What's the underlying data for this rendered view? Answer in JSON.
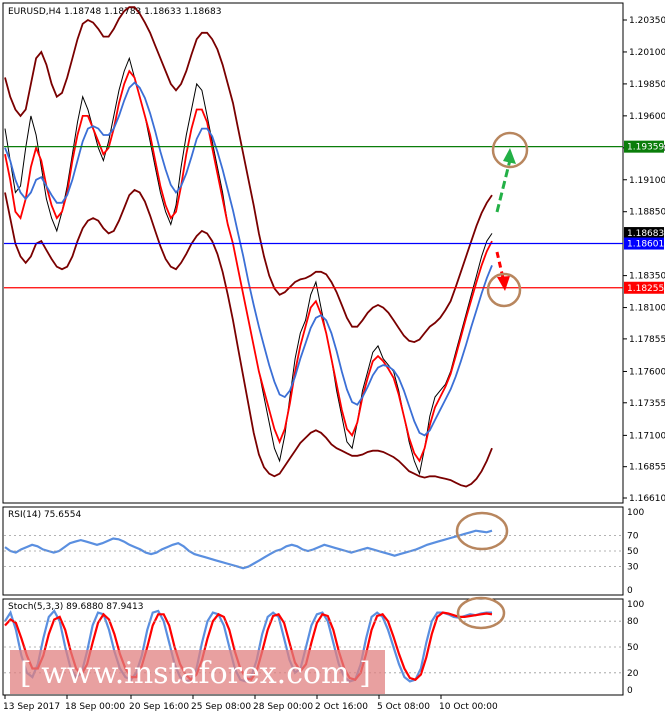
{
  "chart_data": [
    {
      "type": "line",
      "title": "EURUSD,H4  1.18748 1.18783 1.18633 1.18683",
      "symbol": "EURUSD,H4",
      "ohlc": {
        "open": 1.18748,
        "high": 1.18783,
        "low": 1.18633,
        "close": 1.18683
      },
      "ylim": [
        1.1661,
        1.2035
      ],
      "ytick_labels": [
        "1.20350",
        "1.20100",
        "1.19850",
        "1.19600",
        "1.19350",
        "1.19100",
        "1.18850",
        "1.18350",
        "1.18100",
        "1.17855",
        "1.17600",
        "1.17355",
        "1.17100",
        "1.16855",
        "1.16610"
      ],
      "price_levels": [
        {
          "name": "resistance",
          "value": "1.19359",
          "color": "#0a7d0a"
        },
        {
          "name": "current",
          "value": "1.18683",
          "color": "#000000"
        },
        {
          "name": "pivot",
          "value": "1.18601",
          "color": "#0000ff"
        },
        {
          "name": "support",
          "value": "1.18255",
          "color": "#ff0000"
        }
      ],
      "x_labels": [
        "13 Sep 2017",
        "18 Sep 00:00",
        "20 Sep 16:00",
        "25 Sep 08:00",
        "28 Sep 00:00",
        "2 Oct 16:00",
        "5 Oct 08:00",
        "10 Oct 00:00"
      ],
      "series": [
        {
          "name": "price",
          "color": "#000000",
          "values": [
            1.195,
            1.1925,
            1.19,
            1.1905,
            1.1935,
            1.196,
            1.1945,
            1.192,
            1.1895,
            1.188,
            1.187,
            1.1885,
            1.1905,
            1.193,
            1.1955,
            1.1975,
            1.1965,
            1.195,
            1.1935,
            1.1925,
            1.194,
            1.196,
            1.198,
            1.1995,
            1.2005,
            1.199,
            1.1975,
            1.196,
            1.194,
            1.192,
            1.19,
            1.1885,
            1.1875,
            1.189,
            1.192,
            1.1945,
            1.1965,
            1.1985,
            1.198,
            1.196,
            1.194,
            1.192,
            1.19,
            1.1875,
            1.186,
            1.184,
            1.182,
            1.18,
            1.178,
            1.176,
            1.174,
            1.172,
            1.17,
            1.169,
            1.171,
            1.174,
            1.177,
            1.179,
            1.18,
            1.182,
            1.183,
            1.181,
            1.179,
            1.177,
            1.1745,
            1.1725,
            1.1705,
            1.17,
            1.172,
            1.1745,
            1.176,
            1.1775,
            1.178,
            1.177,
            1.1765,
            1.176,
            1.1745,
            1.1725,
            1.1705,
            1.169,
            1.168,
            1.17,
            1.1725,
            1.174,
            1.1745,
            1.175,
            1.176,
            1.1775,
            1.179,
            1.1805,
            1.182,
            1.1835,
            1.185,
            1.1862,
            1.1868
          ]
        },
        {
          "name": "ma-red",
          "color": "#ff0000",
          "values": [
            1.193,
            1.191,
            1.1885,
            1.188,
            1.1895,
            1.192,
            1.1935,
            1.1925,
            1.1905,
            1.189,
            1.188,
            1.1885,
            1.19,
            1.1925,
            1.1945,
            1.196,
            1.196,
            1.195,
            1.194,
            1.193,
            1.1935,
            1.195,
            1.197,
            1.1985,
            1.1995,
            1.199,
            1.1975,
            1.196,
            1.1945,
            1.1925,
            1.1905,
            1.189,
            1.188,
            1.1885,
            1.1905,
            1.193,
            1.195,
            1.1965,
            1.1965,
            1.1955,
            1.1935,
            1.1915,
            1.1895,
            1.1875,
            1.186,
            1.184,
            1.182,
            1.18,
            1.178,
            1.176,
            1.1745,
            1.173,
            1.1715,
            1.1705,
            1.1715,
            1.1735,
            1.176,
            1.178,
            1.1795,
            1.181,
            1.1815,
            1.1805,
            1.179,
            1.177,
            1.175,
            1.173,
            1.1715,
            1.171,
            1.172,
            1.174,
            1.1755,
            1.1768,
            1.1772,
            1.1768,
            1.1762,
            1.1755,
            1.1742,
            1.1725,
            1.1708,
            1.1696,
            1.169,
            1.17,
            1.1718,
            1.1732,
            1.174,
            1.1748,
            1.1758,
            1.1772,
            1.1787,
            1.1802,
            1.1816,
            1.183,
            1.1843,
            1.1854,
            1.1862
          ]
        },
        {
          "name": "ma-blue",
          "color": "#3b6fd6",
          "values": [
            1.1935,
            1.1925,
            1.191,
            1.19,
            1.1895,
            1.19,
            1.191,
            1.1912,
            1.1905,
            1.1898,
            1.1892,
            1.1892,
            1.1898,
            1.191,
            1.1925,
            1.194,
            1.195,
            1.1952,
            1.195,
            1.1945,
            1.1945,
            1.195,
            1.196,
            1.1972,
            1.1982,
            1.1986,
            1.1982,
            1.1974,
            1.1962,
            1.1948,
            1.1932,
            1.1918,
            1.1906,
            1.19,
            1.1905,
            1.1915,
            1.1928,
            1.1942,
            1.195,
            1.195,
            1.1944,
            1.1932,
            1.1918,
            1.1902,
            1.1886,
            1.1868,
            1.185,
            1.183,
            1.1812,
            1.1795,
            1.178,
            1.1765,
            1.1752,
            1.1742,
            1.174,
            1.1745,
            1.1756,
            1.177,
            1.1782,
            1.1794,
            1.1802,
            1.1804,
            1.18,
            1.179,
            1.1776,
            1.176,
            1.1746,
            1.1736,
            1.1734,
            1.174,
            1.1748,
            1.1757,
            1.1763,
            1.1765,
            1.1764,
            1.1761,
            1.1755,
            1.1745,
            1.1733,
            1.1721,
            1.1712,
            1.171,
            1.1714,
            1.1722,
            1.173,
            1.1738,
            1.1746,
            1.1756,
            1.1768,
            1.1781,
            1.1795,
            1.1808,
            1.1821,
            1.1833,
            1.1843
          ]
        },
        {
          "name": "bb-upper",
          "color": "#7a0000",
          "values": [
            1.199,
            1.1975,
            1.1965,
            1.196,
            1.1965,
            1.1985,
            1.2005,
            1.201,
            1.2,
            1.1985,
            1.1975,
            1.1978,
            1.199,
            1.2005,
            1.202,
            1.2032,
            1.2035,
            1.2033,
            1.2028,
            1.2022,
            1.2022,
            1.2028,
            1.2036,
            1.2042,
            1.2045,
            1.2045,
            1.204,
            1.2033,
            1.2025,
            1.2015,
            1.2005,
            1.1995,
            1.1985,
            1.198,
            1.1985,
            1.1995,
            1.2008,
            1.202,
            1.2025,
            1.2025,
            1.202,
            1.2012,
            1.2,
            1.1985,
            1.197,
            1.195,
            1.193,
            1.191,
            1.189,
            1.1868,
            1.185,
            1.1835,
            1.1825,
            1.182,
            1.1822,
            1.1826,
            1.183,
            1.1832,
            1.1833,
            1.1835,
            1.1838,
            1.1838,
            1.1836,
            1.183,
            1.1822,
            1.1812,
            1.1802,
            1.1795,
            1.1795,
            1.18,
            1.1806,
            1.181,
            1.1812,
            1.181,
            1.1806,
            1.18,
            1.1794,
            1.1788,
            1.1784,
            1.1783,
            1.1785,
            1.179,
            1.1795,
            1.1798,
            1.1802,
            1.1808,
            1.1815,
            1.1826,
            1.1838,
            1.185,
            1.1862,
            1.1874,
            1.1884,
            1.1892,
            1.1898
          ]
        },
        {
          "name": "bb-lower",
          "color": "#7a0000",
          "values": [
            1.19,
            1.188,
            1.186,
            1.185,
            1.1845,
            1.185,
            1.186,
            1.1862,
            1.1855,
            1.1848,
            1.1842,
            1.184,
            1.1842,
            1.185,
            1.1862,
            1.1872,
            1.1878,
            1.188,
            1.1878,
            1.1872,
            1.1868,
            1.187,
            1.1878,
            1.1888,
            1.1898,
            1.1902,
            1.19,
            1.1893,
            1.1882,
            1.187,
            1.1858,
            1.1848,
            1.1842,
            1.184,
            1.1845,
            1.1852,
            1.186,
            1.1866,
            1.187,
            1.1868,
            1.1862,
            1.1852,
            1.1838,
            1.182,
            1.18,
            1.1778,
            1.1756,
            1.1734,
            1.1712,
            1.1695,
            1.1685,
            1.168,
            1.1678,
            1.168,
            1.1686,
            1.1692,
            1.1698,
            1.1704,
            1.1708,
            1.1712,
            1.1714,
            1.1712,
            1.1708,
            1.1703,
            1.17,
            1.1698,
            1.1696,
            1.1694,
            1.1694,
            1.1695,
            1.1697,
            1.1698,
            1.1698,
            1.1697,
            1.1695,
            1.1693,
            1.169,
            1.1686,
            1.1682,
            1.168,
            1.1678,
            1.1677,
            1.1678,
            1.1678,
            1.1677,
            1.1676,
            1.1675,
            1.1673,
            1.1671,
            1.167,
            1.1672,
            1.1676,
            1.1682,
            1.169,
            1.17
          ]
        }
      ]
    },
    {
      "type": "line",
      "title": "RSI(14) 75.6554",
      "ylim": [
        0,
        100
      ],
      "ytick_labels": [
        "100",
        "70",
        "50",
        "30",
        "0"
      ],
      "series": [
        {
          "name": "RSI",
          "color": "#5a8fe0",
          "values": [
            55,
            50,
            48,
            52,
            55,
            58,
            56,
            52,
            50,
            48,
            50,
            55,
            60,
            62,
            64,
            62,
            60,
            58,
            60,
            63,
            66,
            65,
            62,
            58,
            55,
            52,
            48,
            46,
            48,
            52,
            55,
            58,
            60,
            56,
            50,
            46,
            44,
            42,
            40,
            38,
            36,
            34,
            32,
            30,
            28,
            30,
            34,
            38,
            42,
            46,
            50,
            52,
            56,
            58,
            56,
            52,
            50,
            52,
            55,
            58,
            56,
            54,
            52,
            50,
            48,
            50,
            52,
            54,
            52,
            50,
            48,
            46,
            44,
            46,
            48,
            50,
            52,
            55,
            58,
            60,
            62,
            64,
            66,
            68,
            70,
            72,
            74,
            76,
            75,
            74,
            76
          ]
        }
      ]
    },
    {
      "type": "line",
      "title": "Stoch(5,3,3) 89.6880 87.9413",
      "ylim": [
        0,
        100
      ],
      "ytick_labels": [
        "100",
        "80",
        "50",
        "20",
        "0"
      ],
      "series": [
        {
          "name": "main",
          "color": "#5a8fe0",
          "values": [
            80,
            90,
            70,
            40,
            20,
            15,
            30,
            60,
            85,
            92,
            80,
            50,
            25,
            15,
            20,
            45,
            75,
            90,
            88,
            70,
            45,
            25,
            15,
            12,
            20,
            40,
            70,
            90,
            92,
            80,
            55,
            30,
            15,
            10,
            12,
            25,
            55,
            80,
            90,
            88,
            75,
            50,
            25,
            12,
            10,
            15,
            35,
            65,
            85,
            90,
            85,
            60,
            35,
            20,
            25,
            50,
            75,
            88,
            90,
            80,
            55,
            30,
            15,
            10,
            12,
            30,
            60,
            85,
            90,
            85,
            70,
            50,
            30,
            15,
            10,
            12,
            25,
            55,
            80,
            90,
            90,
            88,
            85,
            84,
            86,
            88,
            87,
            89,
            90,
            90
          ]
        },
        {
          "name": "signal",
          "color": "#ff0000",
          "values": [
            75,
            82,
            78,
            60,
            40,
            25,
            25,
            40,
            65,
            82,
            85,
            70,
            45,
            25,
            18,
            30,
            55,
            78,
            88,
            82,
            65,
            42,
            25,
            15,
            15,
            28,
            50,
            75,
            88,
            88,
            75,
            50,
            30,
            18,
            12,
            18,
            35,
            60,
            80,
            88,
            85,
            70,
            45,
            25,
            14,
            12,
            22,
            45,
            70,
            86,
            88,
            78,
            55,
            32,
            22,
            30,
            55,
            78,
            88,
            86,
            70,
            45,
            25,
            14,
            12,
            20,
            42,
            70,
            86,
            88,
            80,
            62,
            42,
            25,
            14,
            12,
            18,
            38,
            65,
            85,
            90,
            89,
            87,
            85,
            85,
            86,
            87,
            88,
            89,
            88
          ]
        }
      ]
    }
  ],
  "watermark": "[ www.instaforex.com ]"
}
